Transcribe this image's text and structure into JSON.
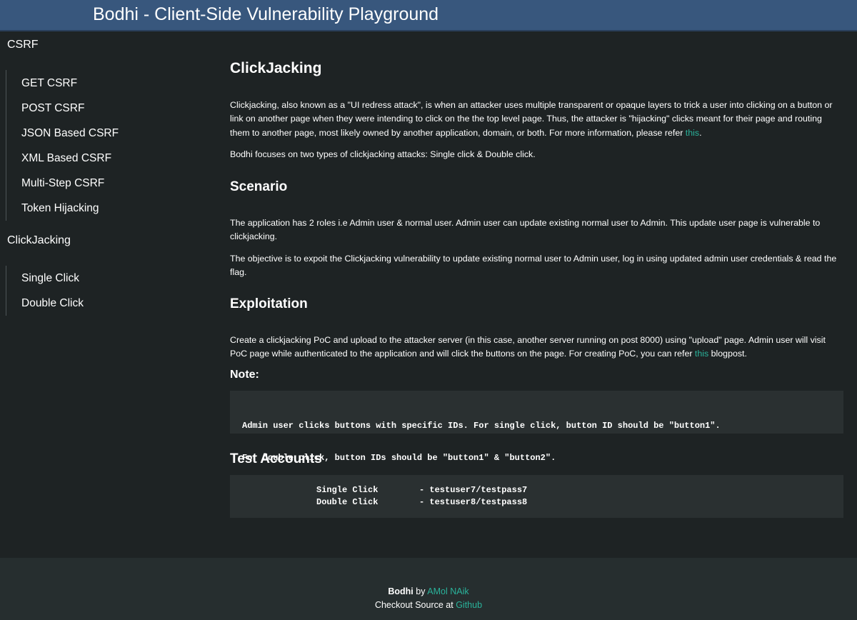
{
  "app": {
    "title": "Bodhi - Client-Side Vulnerability Playground"
  },
  "sidebar": {
    "sections": [
      {
        "title": "CSRF",
        "items": [
          "GET CSRF",
          "POST CSRF",
          "JSON Based CSRF",
          "XML Based CSRF",
          "Multi-Step CSRF",
          "Token Hijacking"
        ]
      },
      {
        "title": "ClickJacking",
        "items": [
          "Single Click",
          "Double Click"
        ]
      }
    ]
  },
  "main": {
    "title": "ClickJacking",
    "intro": {
      "text": "Clickjacking, also known as a \"UI redress attack\", is when an attacker uses multiple transparent or opaque layers to trick a user into clicking on a button or link on another page when they were intending to click on the the top level page. Thus, the attacker is \"hijacking\" clicks meant for their page and routing them to another page, most likely owned by another application, domain, or both. For more information, please refer ",
      "link": "this",
      "after": "."
    },
    "focus": "Bodhi focuses on two types of clickjacking attacks: Single click & Double click.",
    "scenario": {
      "heading": "Scenario",
      "p1": "The application has 2 roles i.e Admin user & normal user. Admin user can update existing normal user to Admin. This update user page is vulnerable to clickjacking.",
      "p2": "The objective is to expoit the Clickjacking vulnerability to update existing normal user to Admin user, log in using updated admin user credentials & read the flag."
    },
    "exploitation": {
      "heading": "Exploitation",
      "text": "Create a clickjacking PoC and upload to the attacker server (in this case, another server running on post 8000) using \"upload\" page. Admin user will visit PoC page while authenticated to the application and will click the buttons on the page. For creating PoC, you can refer ",
      "link": "this",
      "after": " blogpost."
    },
    "note": {
      "heading": "Note:",
      "line1": "Admin user clicks buttons with specific IDs. For single click, button ID should be \"button1\".",
      "line2": "For double click, button IDs should be \"button1\" & \"button2\"."
    },
    "test_accounts": {
      "heading": "Test Accounts",
      "rows": [
        {
          "label": "Single Click",
          "value": "- testuser7/testpass7"
        },
        {
          "label": "Double Click",
          "value": "- testuser8/testpass8"
        }
      ]
    }
  },
  "footer": {
    "brand": "Bodhi",
    "by": " by ",
    "author": "AMol NAik",
    "source_prefix": "Checkout Source at ",
    "source_link": "Github"
  },
  "colors": {
    "header_bg": "#38577d",
    "page_bg": "#1e2324",
    "code_bg": "#2a3031",
    "footer_bg": "#262e2f",
    "link": "#2ab39b"
  }
}
